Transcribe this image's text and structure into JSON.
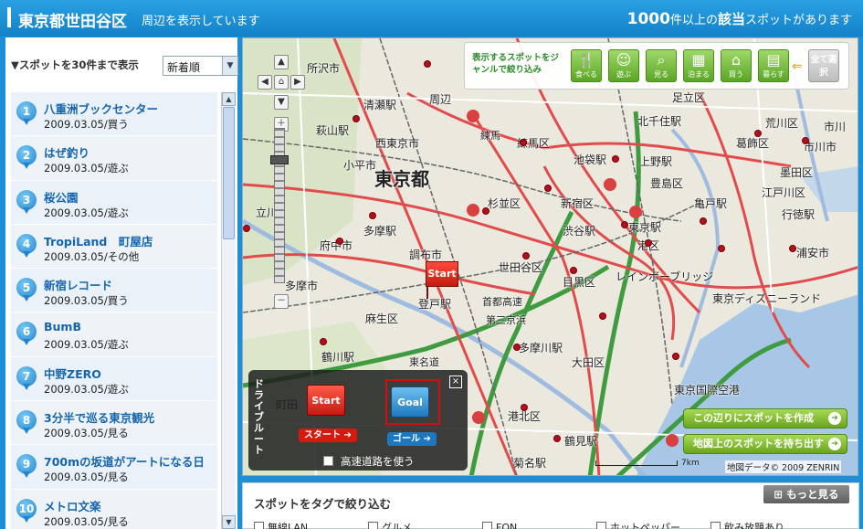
{
  "header": {
    "area": "東京都世田谷区",
    "subtitle": "周辺を表示しています",
    "count": "1000",
    "count_suffix": "件以上の",
    "gaitou": "該当",
    "tail": "スポットがあります"
  },
  "left": {
    "sort_label": "▼スポットを30件まで表示",
    "sort_value": "新着順",
    "items": [
      {
        "num": "1",
        "name": "八重洲ブックセンター",
        "meta": "2009.03.05/買う"
      },
      {
        "num": "2",
        "name": "はぜ釣り",
        "meta": "2009.03.05/遊ぶ"
      },
      {
        "num": "3",
        "name": "桜公園",
        "meta": "2009.03.05/遊ぶ"
      },
      {
        "num": "4",
        "name": "TropiLand　町屋店",
        "meta": "2009.03.05/その他"
      },
      {
        "num": "5",
        "name": "新宿レコード",
        "meta": "2009.03.05/買う"
      },
      {
        "num": "6",
        "name": "BumB",
        "meta": "2009.03.05/遊ぶ"
      },
      {
        "num": "7",
        "name": "中野ZERO",
        "meta": "2009.03.05/遊ぶ"
      },
      {
        "num": "8",
        "name": "3分半で巡る東京観光",
        "meta": "2009.03.05/見る"
      },
      {
        "num": "9",
        "name": "700mの坂道がアートになる日",
        "meta": "2009.03.05/見る"
      },
      {
        "num": "10",
        "name": "メトロ文楽",
        "meta": "2009.03.05/見る"
      }
    ]
  },
  "genre": {
    "label": "表示するスポットをジャンルで絞り込み",
    "buttons": [
      {
        "icon": "fork-knife-icon",
        "glyph": "🍴",
        "label": "食べる"
      },
      {
        "icon": "smile-icon",
        "glyph": "☺",
        "label": "遊ぶ"
      },
      {
        "icon": "magnifier-icon",
        "glyph": "⌕",
        "label": "見る"
      },
      {
        "icon": "building-icon",
        "glyph": "▦",
        "label": "泊まる"
      },
      {
        "icon": "shop-icon",
        "glyph": "⌂",
        "label": "買う"
      },
      {
        "icon": "house-icon",
        "glyph": "▤",
        "label": "暮らす"
      }
    ],
    "all_label": "全て選択"
  },
  "map_labels": [
    "所沢市",
    "周辺",
    "足立区",
    "清瀬駅",
    "北千住駅",
    "荒川区",
    "市川",
    "萩山駅",
    "練馬",
    "練馬区",
    "葛飾区",
    "西東京市",
    "池袋駅",
    "上野駅",
    "市川市",
    "小平市",
    "東京都",
    "豊島区",
    "墨田区",
    "江戸川区",
    "立川",
    "杉並区",
    "新宿区",
    "亀戸駅",
    "行徳駅",
    "多摩駅",
    "府中市",
    "渋谷駅",
    "東京駅",
    "港区",
    "浦安市",
    "調布市",
    "世田谷区",
    "目黒区",
    "レインボーブリッジ",
    "多摩市",
    "登戸駅",
    "東京ディズニーランド",
    "麻生区",
    "多摩川駅",
    "大田区",
    "鶴川駅",
    "東京国際空港",
    "港北区",
    "鶴見駅",
    "菊名駅",
    "町田",
    "第三京浜",
    "東名道",
    "首都高速"
  ],
  "drive": {
    "title": "ドライブルート",
    "start_flag": "Start",
    "goal_flag": "Goal",
    "start_btn": "スタート",
    "goal_btn": "ゴール",
    "highway_label": "高速道路を使う",
    "close": "×"
  },
  "map_start_flag": "Start",
  "actions": {
    "create": "この辺りにスポットを作成",
    "import": "地図上のスポットを持ち出す"
  },
  "scale": "7km",
  "copyright": "地図データ© 2009 ZENRIN",
  "tags": {
    "title": "スポットをタグで絞り込む",
    "more": "もっと見る",
    "items": [
      "無線LAN",
      "グルメ",
      "FON",
      "ホットペッパー",
      "飲み放題あり"
    ]
  },
  "colors": {
    "header_blue": "#1d8fd6",
    "accent_green": "#6aa51c",
    "marker_red": "#b01020",
    "link_blue": "#1565ad"
  }
}
